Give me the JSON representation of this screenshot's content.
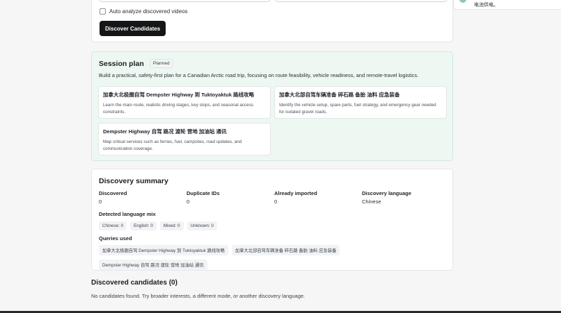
{
  "toast": {
    "text": "电池供电。"
  },
  "discover_form": {
    "auto_analyze_label": "Auto analyze discovered videos",
    "auto_analyze_checked": false,
    "discover_button": "Discover Candidates"
  },
  "session_plan": {
    "title": "Session plan",
    "status": "Planned",
    "description": "Build a practical, safety-first plan for a Canadian Arctic road trip, focusing on route feasibility, vehicle readiness, and remote-travel logistics.",
    "items": [
      {
        "title": "加拿大北极圈自驾 Dempster Highway 到 Tuktoyaktuk 路线攻略",
        "description": "Learn the main route, realistic driving stages, key stops, and seasonal access constraints."
      },
      {
        "title": "加拿大北部自驾车辆准备 碎石路 备胎 油料 应急装备",
        "description": "Identify the vehicle setup, spare parts, fuel strategy, and emergency gear needed for isolated gravel roads."
      },
      {
        "title": "Dempster Highway 自驾 路况 渡轮 营地 加油站 通讯",
        "description": "Map critical services such as ferries, fuel, campsites, road updates, and communication coverage."
      }
    ]
  },
  "discovery_summary": {
    "title": "Discovery summary",
    "stats": [
      {
        "label": "Discovered",
        "value": "0"
      },
      {
        "label": "Duplicate IDs",
        "value": "0"
      },
      {
        "label": "Already imported",
        "value": "0"
      },
      {
        "label": "Discovery language",
        "value": "Chinese"
      }
    ],
    "language_mix_label": "Detected language mix",
    "language_mix": [
      "Chinese: 0",
      "English: 0",
      "Mixed: 0",
      "Unknown: 0"
    ],
    "queries_label": "Queries used",
    "queries": [
      "加拿大北极圈自驾 Dempster Highway 到 Tuktoyaktuk 路线攻略",
      "加拿大北部自驾车辆准备 碎石路 备胎 油料 应急装备",
      "Dempster Highway 自驾 路况 渡轮 营地 加油站 通讯"
    ]
  },
  "candidates": {
    "title": "Discovered candidates (0)",
    "empty_message": "No candidates found. Try broader interests, a different mode, or another discovery language."
  }
}
